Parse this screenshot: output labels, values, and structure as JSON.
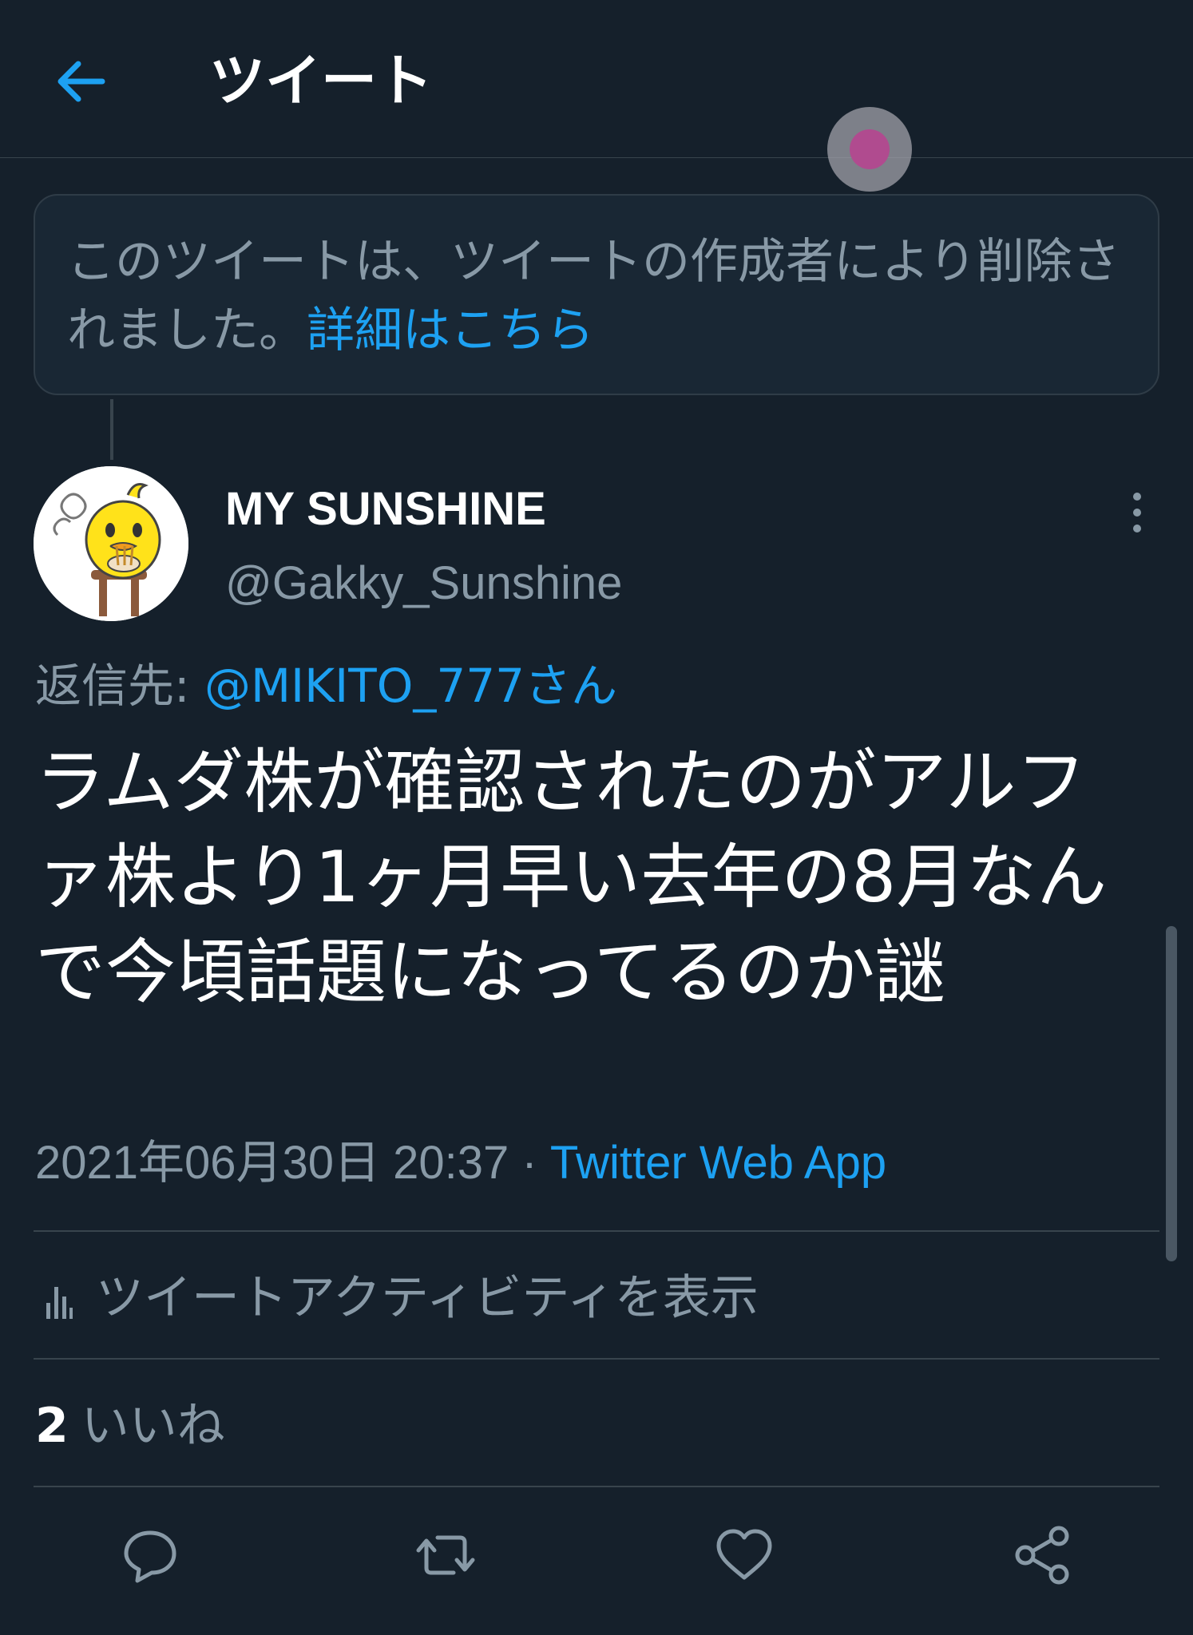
{
  "header": {
    "title": "ツイート",
    "back_icon": "arrow-left-icon"
  },
  "deleted_notice": {
    "text": "このツイートは、ツイートの作成者により削除されました。",
    "link": "詳細はこちら"
  },
  "tweet": {
    "display_name": "MY SUNSHINE",
    "handle": "@Gakky_Sunshine",
    "reply_prefix": "返信先: ",
    "reply_to": "@MIKITO_777さん",
    "text": "ラムダ株が確認されたのがアルファ株より1ヶ月早い去年の8月なんで今頃話題になってるのか謎",
    "datetime": "2021年06月30日 20:37",
    "separator": " · ",
    "source": "Twitter Web App",
    "activity_label": "ツイートアクティビティを表示",
    "likes_count": "2",
    "likes_label": "いいね"
  },
  "actions": [
    "reply-icon",
    "retweet-icon",
    "like-icon",
    "share-icon"
  ],
  "colors": {
    "background": "#15202b",
    "accent": "#1da1f2",
    "muted": "#8899a6",
    "border": "#38444d"
  }
}
